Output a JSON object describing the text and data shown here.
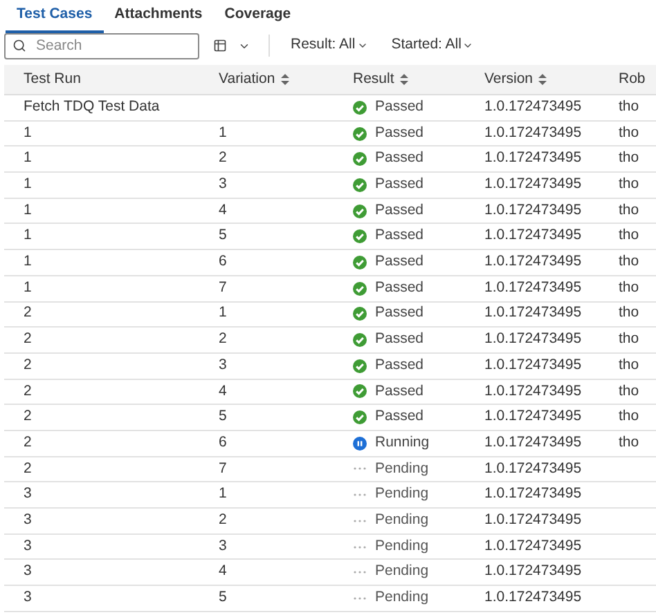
{
  "tabs": [
    {
      "label": "Test Cases",
      "selected": true
    },
    {
      "label": "Attachments",
      "selected": false
    },
    {
      "label": "Coverage",
      "selected": false
    }
  ],
  "search": {
    "placeholder": "Search"
  },
  "filters": [
    {
      "label": "Result: All"
    },
    {
      "label": "Started: All"
    }
  ],
  "table": {
    "columns": [
      {
        "label": "Test Run",
        "sortable": false
      },
      {
        "label": "Variation",
        "sortable": true
      },
      {
        "label": "Result",
        "sortable": true
      },
      {
        "label": "Version",
        "sortable": true
      },
      {
        "label": "Rob",
        "sortable": false
      }
    ],
    "rows": [
      {
        "test_run": "Fetch TDQ Test Data",
        "variation": "",
        "result": {
          "kind": "passed",
          "label": "Passed"
        },
        "version": "1.0.172473495",
        "column_5": "tho"
      },
      {
        "test_run": "1",
        "variation": "1",
        "result": {
          "kind": "passed",
          "label": "Passed"
        },
        "version": "1.0.172473495",
        "column_5": "tho"
      },
      {
        "test_run": "1",
        "variation": "2",
        "result": {
          "kind": "passed",
          "label": "Passed"
        },
        "version": "1.0.172473495",
        "column_5": "tho"
      },
      {
        "test_run": "1",
        "variation": "3",
        "result": {
          "kind": "passed",
          "label": "Passed"
        },
        "version": "1.0.172473495",
        "column_5": "tho"
      },
      {
        "test_run": "1",
        "variation": "4",
        "result": {
          "kind": "passed",
          "label": "Passed"
        },
        "version": "1.0.172473495",
        "column_5": "tho"
      },
      {
        "test_run": "1",
        "variation": "5",
        "result": {
          "kind": "passed",
          "label": "Passed"
        },
        "version": "1.0.172473495",
        "column_5": "tho"
      },
      {
        "test_run": "1",
        "variation": "6",
        "result": {
          "kind": "passed",
          "label": "Passed"
        },
        "version": "1.0.172473495",
        "column_5": "tho"
      },
      {
        "test_run": "1",
        "variation": "7",
        "result": {
          "kind": "passed",
          "label": "Passed"
        },
        "version": "1.0.172473495",
        "column_5": "tho"
      },
      {
        "test_run": "2",
        "variation": "1",
        "result": {
          "kind": "passed",
          "label": "Passed"
        },
        "version": "1.0.172473495",
        "column_5": "tho"
      },
      {
        "test_run": "2",
        "variation": "2",
        "result": {
          "kind": "passed",
          "label": "Passed"
        },
        "version": "1.0.172473495",
        "column_5": "tho"
      },
      {
        "test_run": "2",
        "variation": "3",
        "result": {
          "kind": "passed",
          "label": "Passed"
        },
        "version": "1.0.172473495",
        "column_5": "tho"
      },
      {
        "test_run": "2",
        "variation": "4",
        "result": {
          "kind": "passed",
          "label": "Passed"
        },
        "version": "1.0.172473495",
        "column_5": "tho"
      },
      {
        "test_run": "2",
        "variation": "5",
        "result": {
          "kind": "passed",
          "label": "Passed"
        },
        "version": "1.0.172473495",
        "column_5": "tho"
      },
      {
        "test_run": "2",
        "variation": "6",
        "result": {
          "kind": "running",
          "label": "Running"
        },
        "version": "1.0.172473495",
        "column_5": "tho"
      },
      {
        "test_run": "2",
        "variation": "7",
        "result": {
          "kind": "pending",
          "label": "Pending"
        },
        "version": "1.0.172473495"
      },
      {
        "test_run": "3",
        "variation": "1",
        "result": {
          "kind": "pending",
          "label": "Pending"
        },
        "version": "1.0.172473495"
      },
      {
        "test_run": "3",
        "variation": "2",
        "result": {
          "kind": "pending",
          "label": "Pending"
        },
        "version": "1.0.172473495"
      },
      {
        "test_run": "3",
        "variation": "3",
        "result": {
          "kind": "pending",
          "label": "Pending"
        },
        "version": "1.0.172473495"
      },
      {
        "test_run": "3",
        "variation": "4",
        "result": {
          "kind": "pending",
          "label": "Pending"
        },
        "version": "1.0.172473495"
      },
      {
        "test_run": "3",
        "variation": "5",
        "result": {
          "kind": "pending",
          "label": "Pending"
        },
        "version": "1.0.172473495"
      }
    ]
  }
}
